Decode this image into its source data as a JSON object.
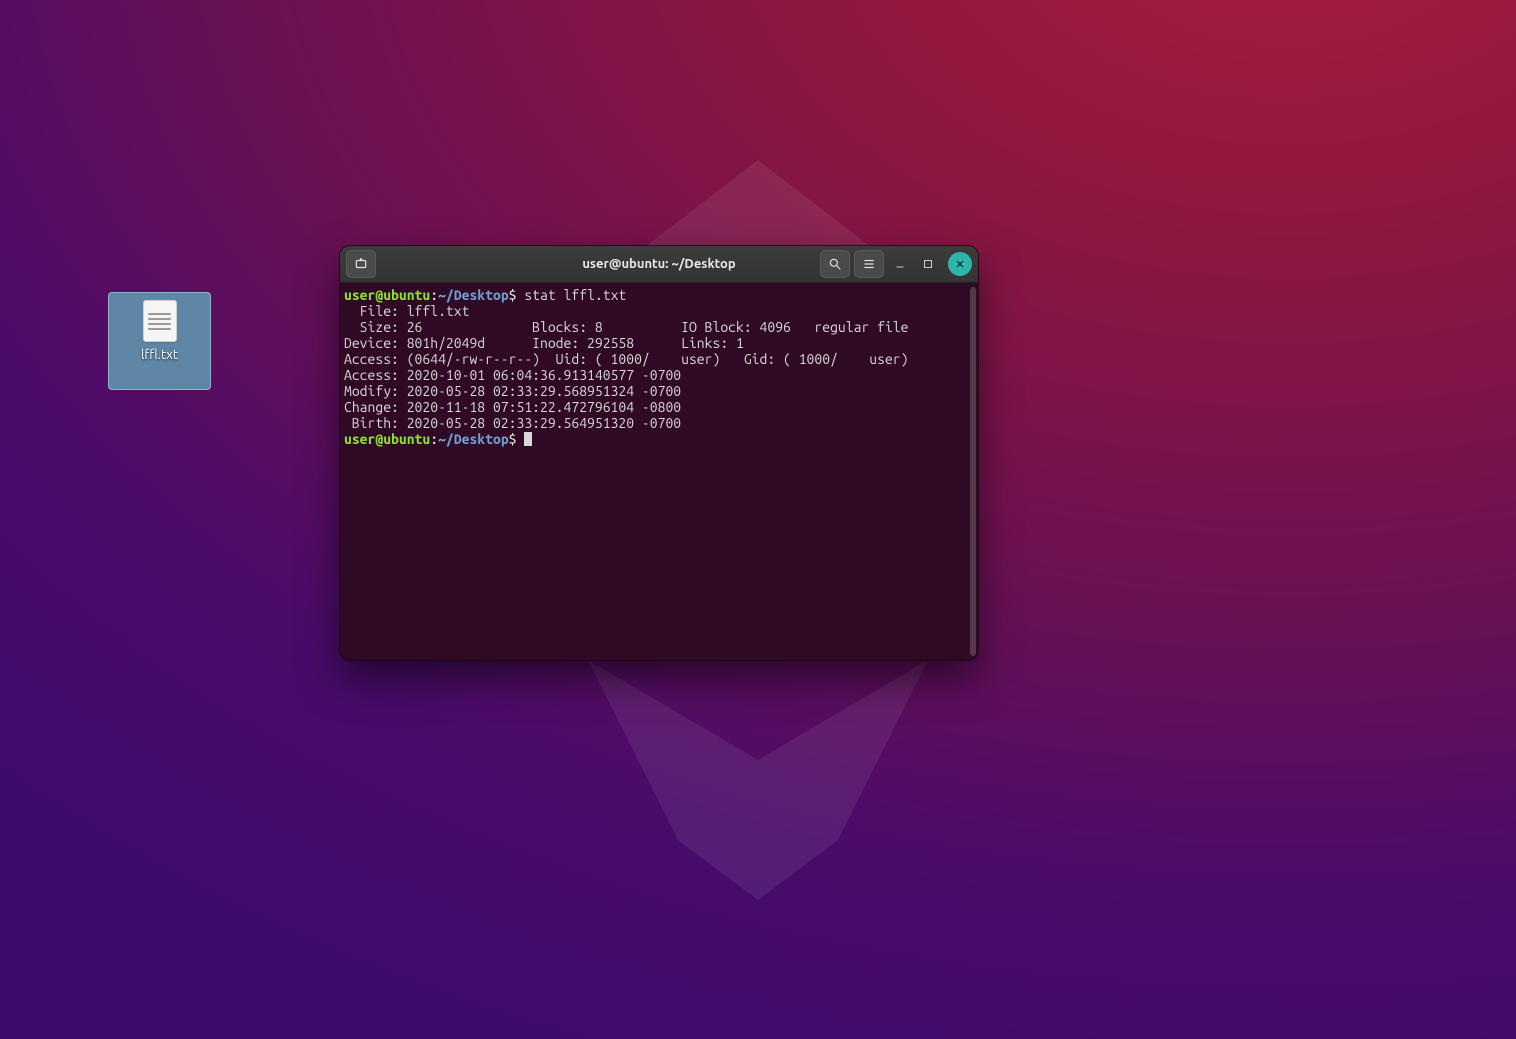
{
  "desktop": {
    "icons": [
      {
        "label": "lffl.txt"
      }
    ]
  },
  "terminal": {
    "title": "user@ubuntu: ~/Desktop",
    "prompt": {
      "user_host": "user@ubuntu",
      "path": "~/Desktop",
      "symbol": "$"
    },
    "command": "stat lffl.txt",
    "output": [
      "  File: lffl.txt",
      "  Size: 26              Blocks: 8          IO Block: 4096   regular file",
      "Device: 801h/2049d      Inode: 292558      Links: 1",
      "Access: (0644/-rw-r--r--)  Uid: ( 1000/    user)   Gid: ( 1000/    user)",
      "Access: 2020-10-01 06:04:36.913140577 -0700",
      "Modify: 2020-05-28 02:33:29.568951324 -0700",
      "Change: 2020-11-18 07:51:22.472796104 -0800",
      " Birth: 2020-05-28 02:33:29.564951320 -0700"
    ]
  }
}
